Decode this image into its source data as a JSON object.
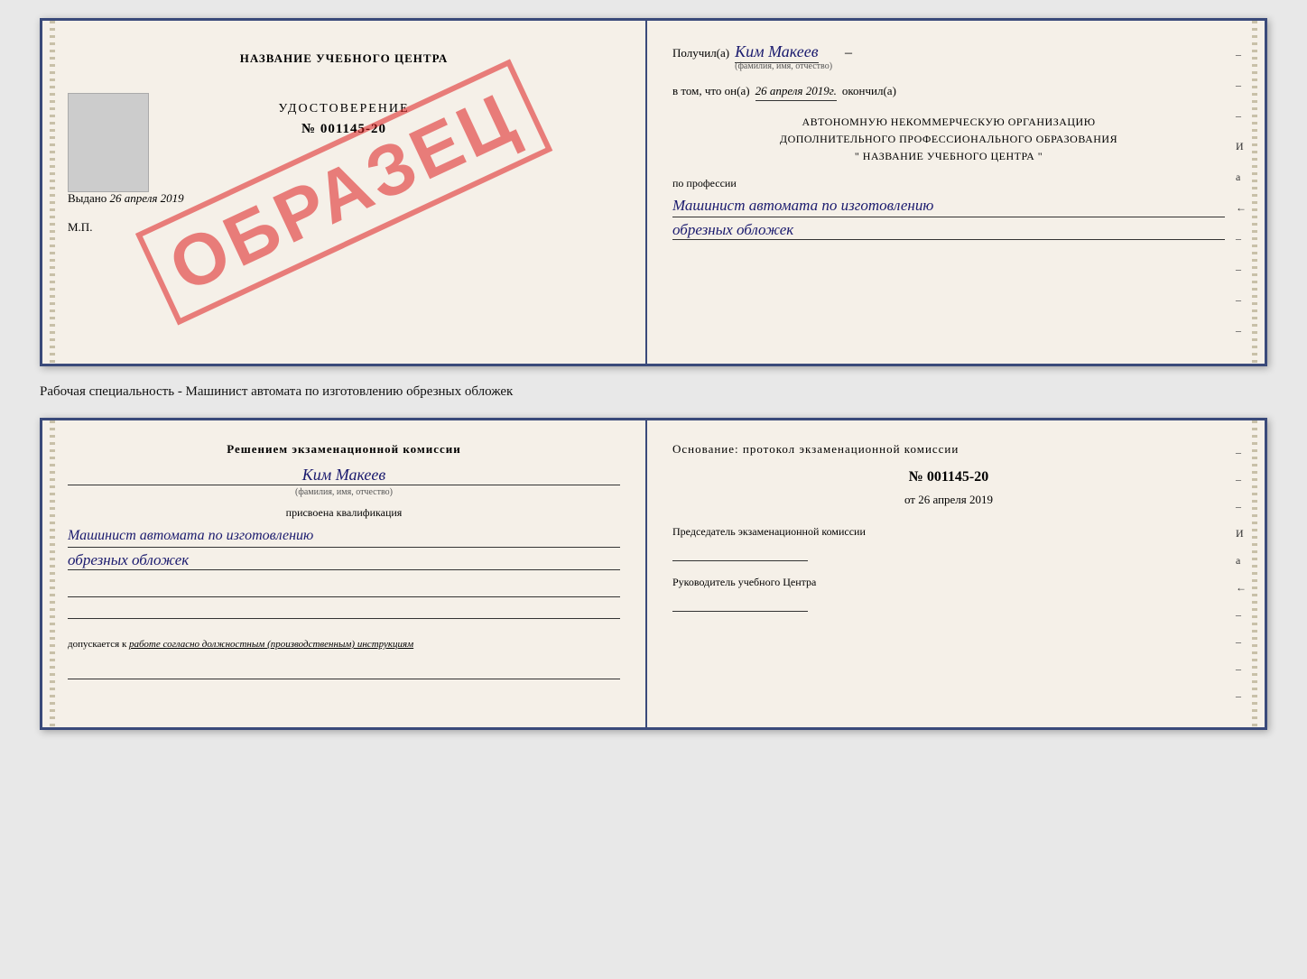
{
  "doc1": {
    "left": {
      "school_name": "НАЗВАНИЕ УЧЕБНОГО ЦЕНТРА",
      "watermark": "ОБРАЗЕЦ",
      "udostoverenie": "УДОСТОВЕРЕНИЕ",
      "number": "№ 001145-20",
      "vydano_label": "Выдано",
      "vydano_date": "26 апреля 2019",
      "mp": "М.П."
    },
    "right": {
      "recipient_prefix": "Получил(а)",
      "recipient_name": "Ким Макеев",
      "fio_caption": "(фамилия, имя, отчество)",
      "date_prefix": "в том, что он(а)",
      "date_value": "26 апреля 2019г.",
      "okonchil": "окончил(а)",
      "org_line1": "АВТОНОМНУЮ НЕКОММЕРЧЕСКУЮ ОРГАНИЗАЦИЮ",
      "org_line2": "ДОПОЛНИТЕЛЬНОГО ПРОФЕССИОНАЛЬНОГО ОБРАЗОВАНИЯ",
      "org_line3": "\"   НАЗВАНИЕ УЧЕБНОГО ЦЕНТРА   \"",
      "profession_label": "по профессии",
      "profession_line1": "Машинист автомата по изготовлению",
      "profession_line2": "обрезных обложек"
    }
  },
  "middle_label": "Рабочая специальность - Машинист автомата по изготовлению обрезных обложек",
  "doc2": {
    "left": {
      "komissia_title": "Решением экзаменационной комиссии",
      "person_name": "Ким Макеев",
      "fio_caption": "(фамилия, имя, отчество)",
      "kvali_label": "присвоена квалификация",
      "kvali_line1": "Машинист автомата по изготовлению",
      "kvali_line2": "обрезных обложек",
      "dopusk_label": "допускается к",
      "dopusk_value": "работе согласно должностным (производственным) инструкциям"
    },
    "right": {
      "osnov_label": "Основание: протокол экзаменационной комиссии",
      "protocol_number": "№ 001145-20",
      "protocol_date_prefix": "от",
      "protocol_date": "26 апреля 2019",
      "chairman_label": "Председатель экзаменационной комиссии",
      "rukovoditel_label": "Руководитель учебного Центра"
    }
  },
  "dash_items": [
    "-",
    "-",
    "-",
    "И",
    "а",
    "←",
    "-",
    "-",
    "-",
    "-"
  ],
  "dash_items2": [
    "-",
    "-",
    "-",
    "И",
    "а",
    "←",
    "-",
    "-",
    "-",
    "-"
  ]
}
